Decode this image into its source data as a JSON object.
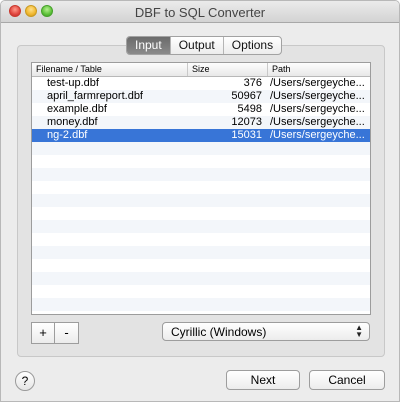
{
  "window": {
    "title": "DBF to SQL Converter"
  },
  "tabs": [
    {
      "label": "Input"
    },
    {
      "label": "Output"
    },
    {
      "label": "Options"
    }
  ],
  "table": {
    "columns": [
      "Filename / Table",
      "Size",
      "Path"
    ],
    "rows": [
      {
        "name": "test-up.dbf",
        "size": "376",
        "path": "/Users/sergeyche..."
      },
      {
        "name": "april_farmreport.dbf",
        "size": "50967",
        "path": "/Users/sergeyche..."
      },
      {
        "name": "example.dbf",
        "size": "5498",
        "path": "/Users/sergeyche..."
      },
      {
        "name": "money.dbf",
        "size": "12073",
        "path": "/Users/sergeyche..."
      },
      {
        "name": "ng-2.dbf",
        "size": "15031",
        "path": "/Users/sergeyche..."
      }
    ],
    "selected_row": "ng-2.dbf"
  },
  "controls": {
    "add_label": "+",
    "remove_label": "-",
    "encoding_value": "Cyrillic (Windows)",
    "encoding_arrows": "updown-arrows-icon"
  },
  "footer": {
    "help_label": "?",
    "next_label": "Next",
    "cancel_label": "Cancel"
  },
  "colors": {
    "selection": "#3875d7",
    "active_tab": "#6b6b6b",
    "close": "#e0443e",
    "minimize": "#f0b72e",
    "zoom": "#5cc138"
  }
}
